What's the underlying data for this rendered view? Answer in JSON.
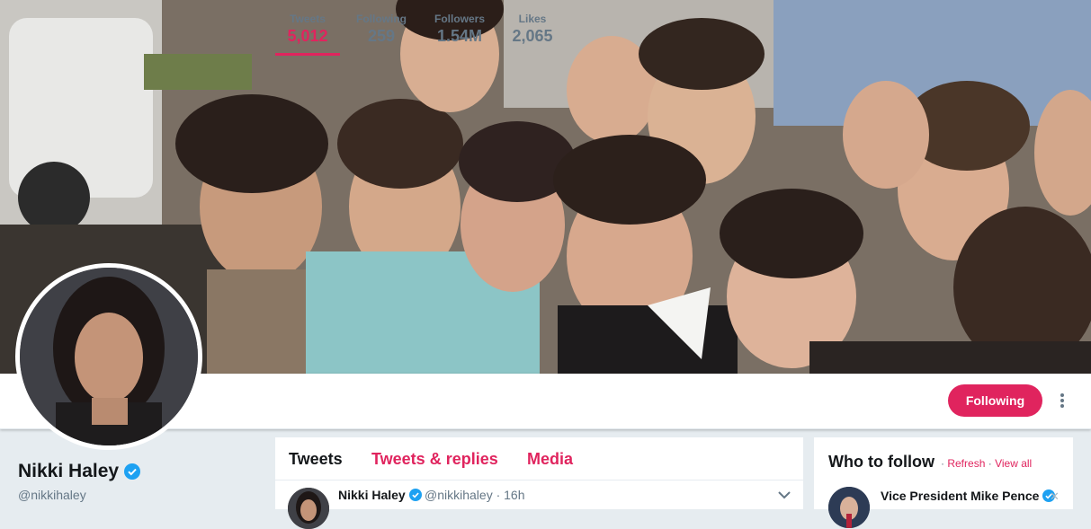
{
  "colors": {
    "accent": "#e0245e",
    "background": "#e6ecf0",
    "muted_text": "#657786",
    "verified": "#1da1f2"
  },
  "banner": {
    "description_icon": "banner-photo-image"
  },
  "profile": {
    "name": "Nikki Haley",
    "handle": "@nikkihaley",
    "verified_icon": "verified-badge-icon"
  },
  "stats": [
    {
      "label": "Tweets",
      "value": "5,012",
      "active": true
    },
    {
      "label": "Following",
      "value": "259",
      "active": false
    },
    {
      "label": "Followers",
      "value": "1.54M",
      "active": false
    },
    {
      "label": "Likes",
      "value": "2,065",
      "active": false
    }
  ],
  "actions": {
    "following_label": "Following",
    "more_icon": "vertical-dots-icon"
  },
  "timeline": {
    "tabs": [
      {
        "label": "Tweets",
        "active": true
      },
      {
        "label": "Tweets & replies",
        "active": false
      },
      {
        "label": "Media",
        "active": false
      }
    ],
    "tweet": {
      "author": "Nikki Haley",
      "handle": "@nikkihaley",
      "separator": "·",
      "time": "16h",
      "caret_icon": "chevron-down-icon"
    }
  },
  "who_to_follow": {
    "title": "Who to follow",
    "separator": "·",
    "refresh_label": "Refresh",
    "view_all_label": "View all",
    "suggestion": {
      "name": "Vice President Mike Pence",
      "dismiss_label": "✕"
    }
  }
}
